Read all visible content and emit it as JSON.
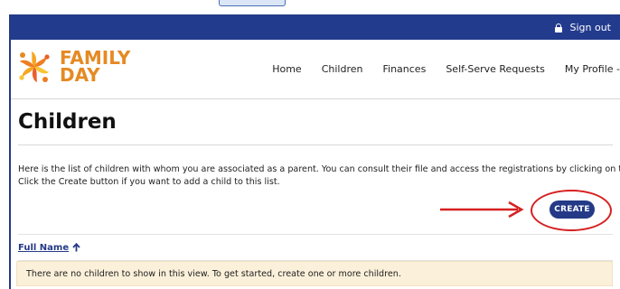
{
  "topbar": {
    "signout_label": "Sign out"
  },
  "brand": {
    "line1": "FAMILY",
    "line2": "DAY"
  },
  "nav": {
    "items": [
      "Home",
      "Children",
      "Finances",
      "Self-Serve Requests",
      "My Profile -"
    ]
  },
  "page": {
    "title": "Children",
    "intro_line1": "Here is the list of children with whom you are associated as a parent. You can consult their file and access the registrations by clicking on their name.",
    "intro_line2": "Click the Create button if you want to add a child to this list."
  },
  "actions": {
    "create_label": "CREATE"
  },
  "table": {
    "columns": [
      "Full Name"
    ],
    "empty_message": "There are no children to show in this view. To get started, create one or more children."
  },
  "colors": {
    "primary": "#233b8d",
    "brand_orange": "#e58a23",
    "annotation_red": "#d62020",
    "empty_row_bg": "#fbf0d9"
  },
  "icons": [
    "lock-icon",
    "family-day-logo",
    "sort-ascending-icon",
    "annotation-arrow"
  ]
}
